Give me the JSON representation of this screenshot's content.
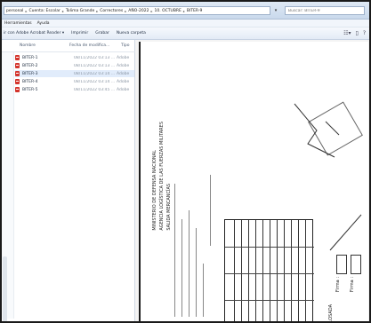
{
  "address_bar": {
    "crumbs": [
      "personal",
      "Cuenta: Escolar",
      "Tolima Grande",
      "Correctores",
      "AÑO-2022",
      "10. OCTUBRE",
      "BITER-9"
    ],
    "search_placeholder": "Buscar: BITER-9"
  },
  "menu": {
    "items": [
      "Herramientas",
      "Ayuda"
    ]
  },
  "toolbar": {
    "open_with": "ir con Adobe Acrobat Reader",
    "print": "Imprimir",
    "burn": "Grabar",
    "new_folder": "Nueva carpeta"
  },
  "file_list": {
    "headers": {
      "name": "Nombre",
      "date": "Fecha de modifica...",
      "type": "Tipo"
    },
    "files": [
      {
        "name": "BITER-1",
        "date": "08/11/2022 03:13 ...",
        "type": "Adobe",
        "selected": false
      },
      {
        "name": "BITER-2",
        "date": "08/11/2022 03:13 ...",
        "type": "Adobe",
        "selected": false
      },
      {
        "name": "BITER-3",
        "date": "08/11/2022 03:14 ...",
        "type": "Adobe",
        "selected": true
      },
      {
        "name": "BITER-4",
        "date": "08/11/2022 03:14 ...",
        "type": "Adobe",
        "selected": false
      },
      {
        "name": "BITER-5",
        "date": "08/11/2022 03:45 ...",
        "type": "Adobe",
        "selected": false
      }
    ]
  },
  "preview": {
    "header_lines": [
      "MINISTERIO DE DEFENSA NACIONAL",
      "AGENCIA LOGÍSTICA DE LAS FUERZAS MILITARES",
      "SALIDA MERCANCÍAS"
    ],
    "footer_label": "CLOSADA",
    "sign_label_1": "Firma :",
    "sign_label_2": "Firma :"
  },
  "colors": {
    "pdf_icon": "#d4342c",
    "selected_row": "#e1ecfb"
  }
}
